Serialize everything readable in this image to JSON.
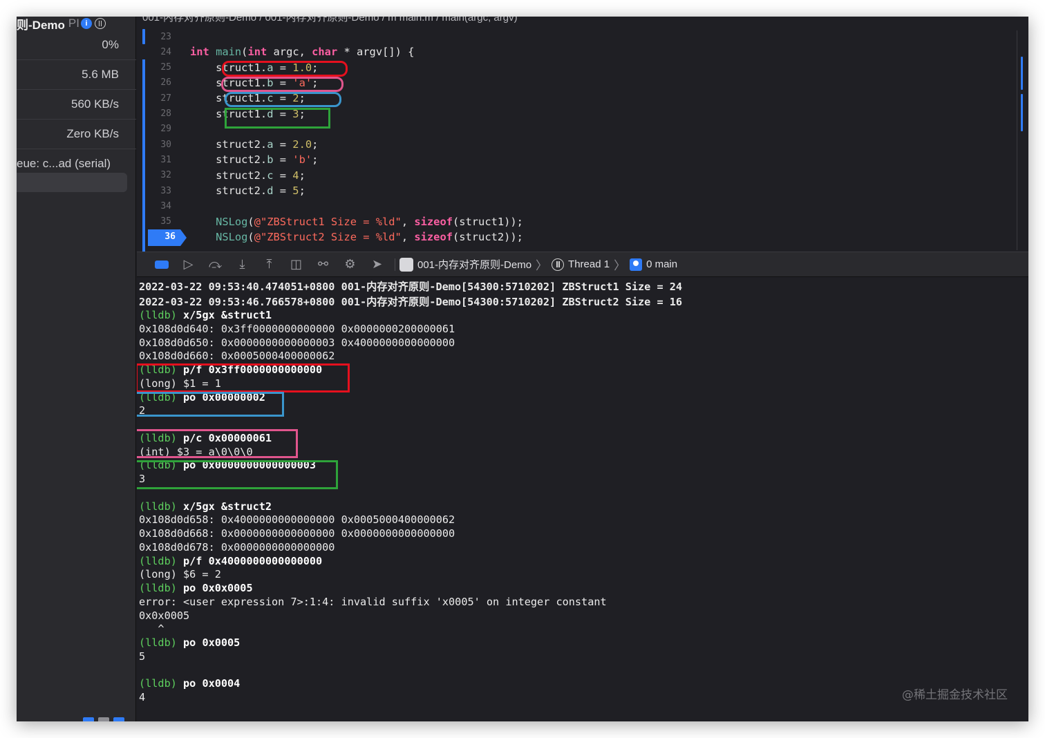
{
  "sidebar": {
    "title": "则-Demo",
    "title_suffix": "PI",
    "info_icon": "info-icon",
    "thread_icon": "thread-icon",
    "rows": [
      "0%",
      "5.6 MB",
      "560 KB/s",
      "Zero KB/s",
      "eue: c...ad (serial)"
    ]
  },
  "editor": {
    "breadcrumb": "001-内存对齐原则-Demo  /  001-内存对齐原则-Demo  /  m  main.m  /  main(argc, argv)",
    "current_line": "36",
    "lines": [
      {
        "n": "23",
        "html": ""
      },
      {
        "n": "24",
        "html": "<span class='kw'>int</span> <span class='fn'>main</span>(<span class='kw'>int</span> argc, <span class='kw'>char</span> * argv[]) {"
      },
      {
        "n": "25",
        "html": "    struct1.<span class='mem'>a</span> = <span class='num'>1.0</span>;"
      },
      {
        "n": "26",
        "html": "    struct1.<span class='mem'>b</span> = <span class='str'>'a'</span>;"
      },
      {
        "n": "27",
        "html": "    struct1.<span class='mem'>c</span> = <span class='num'>2</span>;"
      },
      {
        "n": "28",
        "html": "    struct1.<span class='mem'>d</span> = <span class='num'>3</span>;"
      },
      {
        "n": "29",
        "html": ""
      },
      {
        "n": "30",
        "html": "    struct2.<span class='mem'>a</span> = <span class='num'>2.0</span>;"
      },
      {
        "n": "31",
        "html": "    struct2.<span class='mem'>b</span> = <span class='str'>'b'</span>;"
      },
      {
        "n": "32",
        "html": "    struct2.<span class='mem'>c</span> = <span class='num'>4</span>;"
      },
      {
        "n": "33",
        "html": "    struct2.<span class='mem'>d</span> = <span class='num'>5</span>;"
      },
      {
        "n": "34",
        "html": ""
      },
      {
        "n": "35",
        "html": "    <span class='fn'>NSLog</span>(<span class='str'>@\"ZBStruct1 Size = %ld\"</span>, <span class='kw'>sizeof</span>(struct1));"
      },
      {
        "n": "36",
        "html": "    <span class='fn'>NSLog</span>(<span class='str'>@\"ZBStruct2 Size = %ld\"</span>, <span class='kw'>sizeof</span>(struct2));"
      }
    ]
  },
  "debugbar": {
    "buttons": [
      "breakpoints-toggle",
      "continue",
      "step-over",
      "step-into",
      "step-out",
      "view-hierarchy",
      "memory-graph",
      "environment-overrides",
      "simulate-location"
    ],
    "app_name": "001-内存对齐原则-Demo",
    "thread": "Thread 1",
    "frame": "0 main"
  },
  "console": {
    "lines": [
      {
        "prompt": "",
        "text": "2022-03-22 09:53:40.474051+0800 001-内存对齐原则-Demo[54300:5710202] ZBStruct1 Size = 24"
      },
      {
        "prompt": "",
        "text": "2022-03-22 09:53:46.766578+0800 001-内存对齐原则-Demo[54300:5710202] ZBStruct2 Size = 16"
      },
      {
        "prompt": "(lldb)",
        "text": " x/5gx &struct1"
      },
      {
        "prompt": "",
        "text": "0x108d0d640: 0x3ff0000000000000 0x0000000200000061"
      },
      {
        "prompt": "",
        "text": "0x108d0d650: 0x0000000000000003 0x4000000000000000"
      },
      {
        "prompt": "",
        "text": "0x108d0d660: 0x0005000400000062"
      },
      {
        "prompt": "(lldb)",
        "text": " p/f 0x3ff0000000000000"
      },
      {
        "prompt": "",
        "text": "(long) $1 = 1"
      },
      {
        "prompt": "(lldb)",
        "text": " po 0x00000002"
      },
      {
        "prompt": "",
        "text": "2"
      },
      {
        "prompt": "",
        "text": ""
      },
      {
        "prompt": "(lldb)",
        "text": " p/c 0x00000061"
      },
      {
        "prompt": "",
        "text": "(int) $3 = a\\0\\0\\0"
      },
      {
        "prompt": "(lldb)",
        "text": " po 0x0000000000000003"
      },
      {
        "prompt": "",
        "text": "3"
      },
      {
        "prompt": "",
        "text": ""
      },
      {
        "prompt": "(lldb)",
        "text": " x/5gx &struct2"
      },
      {
        "prompt": "",
        "text": "0x108d0d658: 0x4000000000000000 0x0005000400000062"
      },
      {
        "prompt": "",
        "text": "0x108d0d668: 0x0000000000000000 0x0000000000000000"
      },
      {
        "prompt": "",
        "text": "0x108d0d678: 0x0000000000000000"
      },
      {
        "prompt": "(lldb)",
        "text": " p/f 0x4000000000000000"
      },
      {
        "prompt": "",
        "text": "(long) $6 = 2"
      },
      {
        "prompt": "(lldb)",
        "text": " po 0x0x0005"
      },
      {
        "prompt": "",
        "text": "error: <user expression 7>:1:4: invalid suffix 'x0005' on integer constant"
      },
      {
        "prompt": "",
        "text": "0x0x0005"
      },
      {
        "prompt": "",
        "text": "   ^"
      },
      {
        "prompt": "(lldb)",
        "text": " po 0x0005"
      },
      {
        "prompt": "",
        "text": "5"
      },
      {
        "prompt": "",
        "text": ""
      },
      {
        "prompt": "(lldb)",
        "text": " po 0x0004"
      },
      {
        "prompt": "",
        "text": "4"
      }
    ]
  },
  "colors": {
    "accent": "#2f7bf6",
    "annotation_red": "#e5101e",
    "annotation_pink": "#e0558d",
    "annotation_blue": "#3a95cc",
    "annotation_green": "#2ea33a",
    "lldb_prompt": "#5ecf5e"
  },
  "watermark": "@稀土掘金技术社区"
}
